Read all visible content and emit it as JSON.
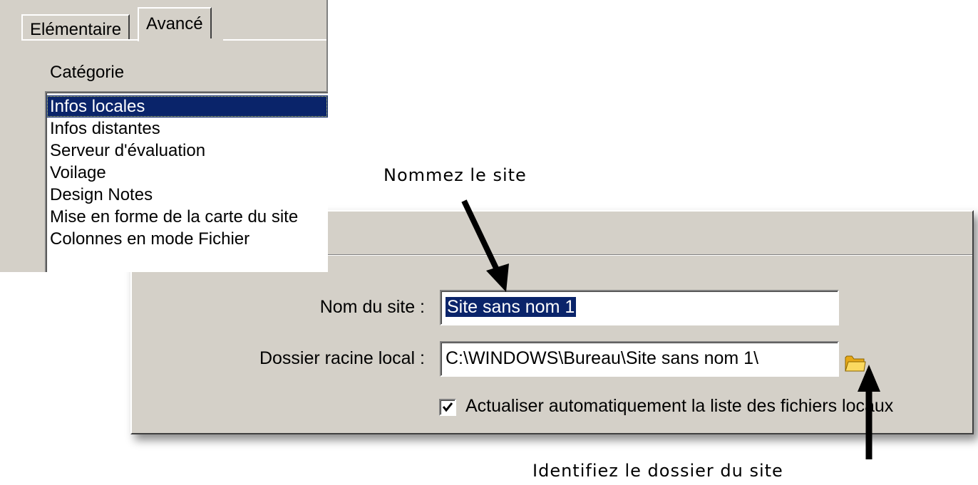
{
  "tabs": [
    {
      "label": "Elémentaire",
      "active": false
    },
    {
      "label": "Avancé",
      "active": true
    }
  ],
  "category": {
    "heading": "Catégorie",
    "items": [
      {
        "label": "Infos locales",
        "selected": true
      },
      {
        "label": "Infos distantes",
        "selected": false
      },
      {
        "label": "Serveur d'évaluation",
        "selected": false
      },
      {
        "label": "Voilage",
        "selected": false
      },
      {
        "label": "Design Notes",
        "selected": false
      },
      {
        "label": "Mise en forme de la carte du site",
        "selected": false
      },
      {
        "label": "Colonnes en mode Fichier",
        "selected": false
      }
    ]
  },
  "form": {
    "site_name_label": "Nom du site :",
    "site_name_value": "Site sans nom 1",
    "local_root_label": "Dossier racine local :",
    "local_root_value": "C:\\WINDOWS\\Bureau\\Site sans nom 1\\",
    "auto_refresh_label": "Actualiser automatiquement la liste des fichiers locaux",
    "auto_refresh_checked": true
  },
  "annotations": {
    "name_site": "Nommez le site",
    "identify_folder": "Identifiez le dossier du site"
  },
  "icons": {
    "folder": "folder-icon",
    "checkmark": "checkmark-icon",
    "arrow": "arrow-icon"
  },
  "colors": {
    "dialog_bg": "#d4d0c8",
    "selection": "#0a246a",
    "folder_yellow": "#f5c542"
  }
}
